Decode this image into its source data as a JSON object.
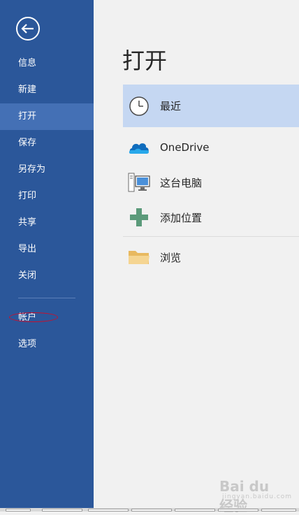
{
  "sidebar": {
    "items": [
      {
        "label": "信息"
      },
      {
        "label": "新建"
      },
      {
        "label": "打开"
      },
      {
        "label": "保存"
      },
      {
        "label": "另存为"
      },
      {
        "label": "打印"
      },
      {
        "label": "共享"
      },
      {
        "label": "导出"
      },
      {
        "label": "关闭"
      },
      {
        "label": "帐户"
      },
      {
        "label": "选项"
      }
    ],
    "active_item": "打开"
  },
  "main": {
    "title": "打开",
    "locations": [
      {
        "label": "最近",
        "icon": "clock-icon"
      },
      {
        "label": "OneDrive",
        "icon": "onedrive-cloud-icon"
      },
      {
        "label": "这台电脑",
        "icon": "computer-icon"
      },
      {
        "label": "添加位置",
        "icon": "plus-icon"
      },
      {
        "label": "浏览",
        "icon": "folder-icon"
      }
    ]
  },
  "colors": {
    "sidebar_bg": "#2b579a",
    "sidebar_active": "#4470b5",
    "selected_location_bg": "#c5d7f2",
    "plus_icon": "#5b9a7a",
    "annotation": "#c8102e"
  },
  "watermark": {
    "text": "Bai du 经验",
    "subtext": "jingyan.baidu.com"
  }
}
